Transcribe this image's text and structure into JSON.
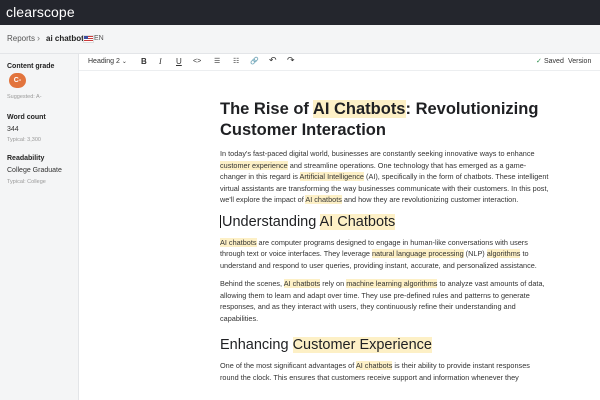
{
  "app": {
    "title": "clearscope"
  },
  "breadcrumb": {
    "parent": "Reports",
    "separator": "›",
    "current": "ai chatbot",
    "language": "EN"
  },
  "sidebar": {
    "content_grade": {
      "label": "Content grade",
      "grade": "C-",
      "suggested": "Suggested: A-"
    },
    "word_count": {
      "label": "Word count",
      "value": "344",
      "typical": "Typical: 3,300"
    },
    "readability": {
      "label": "Readability",
      "value": "College Graduate",
      "typical": "Typical: College"
    }
  },
  "toolbar": {
    "heading_select": "Heading 2",
    "buttons": [
      {
        "name": "bold-button",
        "label": "B"
      },
      {
        "name": "italic-button",
        "label": "I"
      },
      {
        "name": "underline-button",
        "label": "U"
      },
      {
        "name": "code-button",
        "label": "<>"
      },
      {
        "name": "bullet-list-button",
        "label": "☰"
      },
      {
        "name": "numbered-list-button",
        "label": "☷"
      },
      {
        "name": "link-button",
        "label": "🔗"
      },
      {
        "name": "undo-button",
        "label": "↶"
      },
      {
        "name": "redo-button",
        "label": "↷"
      }
    ],
    "saved_label": "Saved",
    "version_label": "Version"
  },
  "document": {
    "title": [
      {
        "text": "The Rise of "
      },
      {
        "text": "AI Chatbots",
        "hl": true
      },
      {
        "text": ": Revolutionizing Customer Interaction"
      }
    ],
    "intro": [
      {
        "text": "In today's fast-paced digital world, businesses are constantly seeking innovative ways to enhance "
      },
      {
        "text": "customer experience",
        "hl": true
      },
      {
        "text": " and streamline operations. One technology that has emerged as a game-changer in this regard is "
      },
      {
        "text": "Artificial Intelligence",
        "hl": true
      },
      {
        "text": " (AI), specifically in the form of chatbots. These intelligent virtual assistants are transforming the way businesses communicate with their customers. In this post, we'll explore the impact of "
      },
      {
        "text": "AI chatbots",
        "hl": true
      },
      {
        "text": " and how they are revolutionizing customer interaction."
      }
    ],
    "h2_1": [
      {
        "text": "Understanding "
      },
      {
        "text": "AI Chatbots",
        "hl": true
      }
    ],
    "p2": [
      {
        "text": "AI chatbots",
        "hl": true
      },
      {
        "text": " are computer programs designed to engage in human-like conversations with users through text or voice interfaces. They leverage "
      },
      {
        "text": "natural language processing",
        "hl": true
      },
      {
        "text": " (NLP) "
      },
      {
        "text": "algorithms",
        "hl": true
      },
      {
        "text": " to understand and respond to user queries, providing instant, accurate, and personalized assistance."
      }
    ],
    "p3": [
      {
        "text": "Behind the scenes, "
      },
      {
        "text": "AI chatbots",
        "hl": true
      },
      {
        "text": " rely on "
      },
      {
        "text": "machine learning algorithms",
        "hl": true
      },
      {
        "text": " to analyze vast amounts of data, allowing them to learn and adapt over time. They use pre-defined rules and patterns to generate responses, and as they interact with users, they continuously refine their understanding and capabilities."
      }
    ],
    "h2_2": [
      {
        "text": "Enhancing "
      },
      {
        "text": "Customer Experience",
        "hl": true
      }
    ],
    "p4": [
      {
        "text": "One of the most significant advantages of "
      },
      {
        "text": "AI chatbots",
        "hl": true
      },
      {
        "text": " is their ability to provide instant responses round the clock. This ensures that customers receive support and information whenever they"
      }
    ]
  }
}
